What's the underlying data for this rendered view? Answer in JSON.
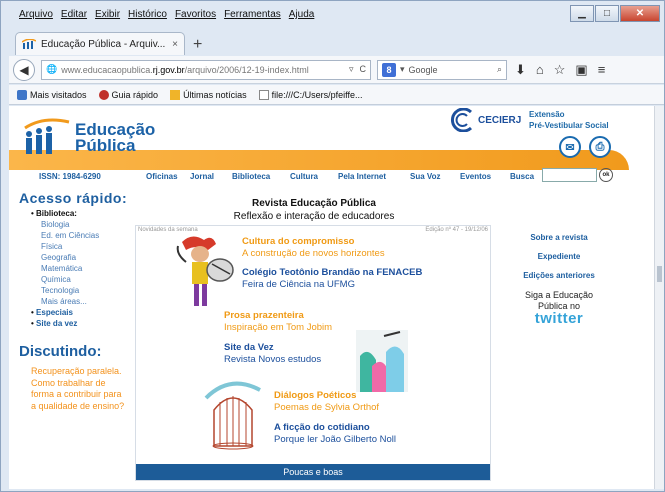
{
  "browser": {
    "menu": [
      "Arquivo",
      "Editar",
      "Exibir",
      "Histórico",
      "Favoritos",
      "Ferramentas",
      "Ajuda"
    ],
    "tab_title": "Educação Pública - Arquiv...",
    "tab_close": "×",
    "new_tab": "+",
    "url_prefix": "www.educacaopublica.",
    "url_domain": "rj.gov.br",
    "url_suffix": "/arquivo/2006/12-19-index.html",
    "search_engine_label": "Google",
    "bookmarks": [
      "Mais visitados",
      "Guia rápido",
      "Últimas notícias",
      "file:///C:/Users/pfeiffe..."
    ]
  },
  "header": {
    "logo_line1": "Educação",
    "logo_line2": "Pública",
    "cecierj": "CECIERJ",
    "extensao_line1": "Extensão",
    "extensao_line2": "Pré-Vestibular Social"
  },
  "nav": {
    "issn": "ISSN: 1984-6290",
    "items": [
      "Oficinas",
      "Jornal",
      "Biblioteca",
      "Cultura",
      "Pela Internet",
      "Sua Voz",
      "Eventos",
      "Busca"
    ],
    "busca_go": "ok"
  },
  "sidebar": {
    "title": "Acesso rápido:",
    "biblioteca": "Biblioteca:",
    "sub_items": [
      "Biologia",
      "Ed. em Ciências",
      "Física",
      "Geografia",
      "Matemática",
      "Química",
      "Tecnologia",
      "Mais áreas..."
    ],
    "especiais": "Especiais",
    "site_da_vez": "Site da vez",
    "discutindo_title": "Discutindo:",
    "discutindo_text": "Recuperação paralela. Como trabalhar de forma a contribuir para a qualidade de ensino?"
  },
  "main": {
    "title": "Revista Educação Pública",
    "subtitle": "Reflexão e interação de educadores",
    "box_left": "Novidades da semana",
    "box_right": "Edição nº 47 - 19/12/06",
    "stories": [
      {
        "title": "Cultura do compromisso",
        "sub": "A construção de novos horizontes"
      },
      {
        "title": "Colégio Teotônio Brandão na FENACEB",
        "sub": "Feira de Ciência na UFMG"
      },
      {
        "title": "Prosa prazenteira",
        "sub": "Inspiração em Tom Jobim"
      },
      {
        "title": "Site da Vez",
        "sub": "Revista Novos estudos"
      },
      {
        "title": "Diálogos Poéticos",
        "sub": "Poemas de Sylvia Orthof"
      },
      {
        "title": "A ficção do cotidiano",
        "sub": "Porque ler João Gilberto Noll"
      }
    ],
    "bottom_bar": "Poucas e boas"
  },
  "rightcol": {
    "links": [
      "Sobre a revista",
      "Expediente",
      "Edições anteriores"
    ],
    "siga_line1": "Siga a Educação",
    "siga_line2": "Pública no",
    "twitter": "twitter"
  },
  "colors": {
    "brand_blue": "#1c62a7",
    "orange": "#f19a1c",
    "bottom_bar": "#1d5c98",
    "twitter": "#35a3d8"
  }
}
